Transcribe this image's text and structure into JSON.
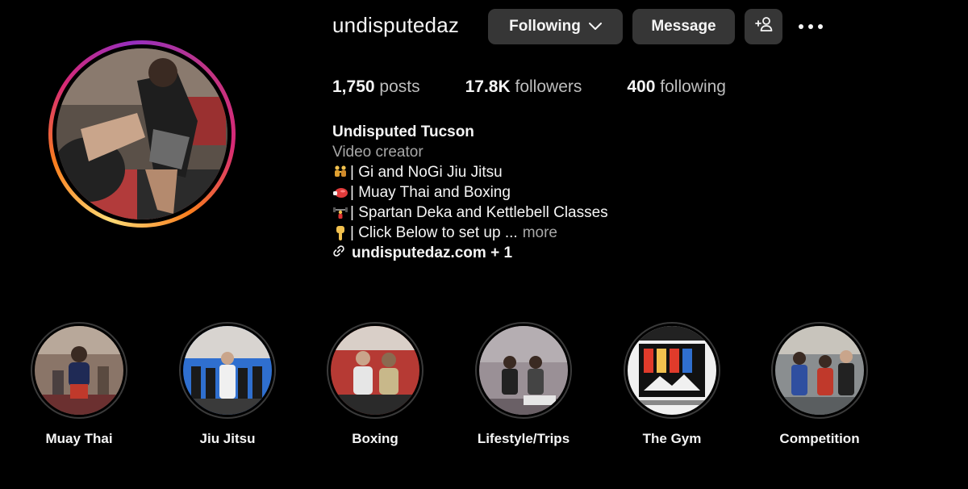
{
  "profile": {
    "username": "undisputedaz",
    "following_button": "Following",
    "message_button": "Message",
    "add_user_icon": "add-user-icon",
    "more_icon": "ellipsis-icon"
  },
  "stats": {
    "posts_count": "1,750",
    "posts_label": "posts",
    "followers_count": "17.8K",
    "followers_label": "followers",
    "following_count": "400",
    "following_label": "following"
  },
  "bio": {
    "name": "Undisputed Tucson",
    "category": "Video creator",
    "lines": [
      {
        "icon": "wrestling-emoji",
        "text": "| Gi and NoGi Jiu Jitsu"
      },
      {
        "icon": "boxing-glove-emoji",
        "text": "| Muay Thai and Boxing"
      },
      {
        "icon": "weightlifter-emoji",
        "text": "| Spartan Deka and Kettlebell Classes"
      },
      {
        "icon": "pointing-down-emoji",
        "text": "| Click Below to set up ..."
      }
    ],
    "more_label": "more",
    "link_text": "undisputedaz.com + 1"
  },
  "highlights": [
    {
      "label": "Muay Thai"
    },
    {
      "label": "Jiu Jitsu"
    },
    {
      "label": "Boxing"
    },
    {
      "label": "Lifestyle/Trips"
    },
    {
      "label": "The Gym"
    },
    {
      "label": "Competition"
    }
  ],
  "colors": {
    "background": "#000000",
    "button": "#363636",
    "muted_text": "#a8a8a8",
    "story_ring": [
      "#feda75",
      "#fa7e1e",
      "#d62976",
      "#962fbf"
    ]
  }
}
